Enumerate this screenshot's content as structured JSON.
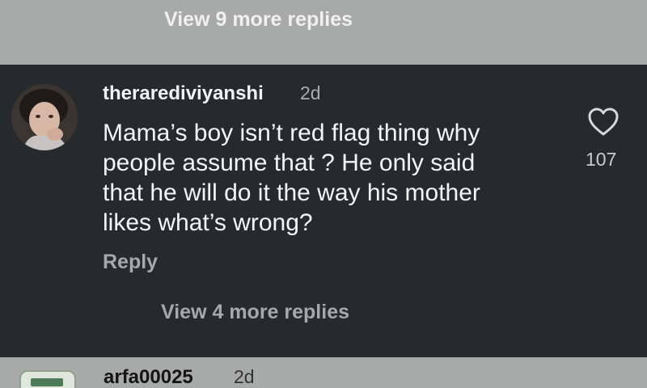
{
  "top_thread": {
    "view_replies_label": "View 9 more replies"
  },
  "comment": {
    "username": "therarediviyanshi",
    "timestamp": "2d",
    "text": "Mama’s boy isn’t red flag thing why\npeople assume that ? He only said\nthat he will do it the way his mother\nlikes what’s wrong?",
    "reply_label": "Reply",
    "like_icon": "heart-outline-icon",
    "like_count": "107",
    "view_replies_label": "View 4 more replies"
  },
  "next_comment": {
    "username": "arfa00025",
    "timestamp": "2d"
  },
  "colors": {
    "background_dark": "#262a2d",
    "background_gray": "#a8aaa9",
    "text_primary": "#f5f5f5",
    "text_secondary": "#a6a9ab"
  }
}
